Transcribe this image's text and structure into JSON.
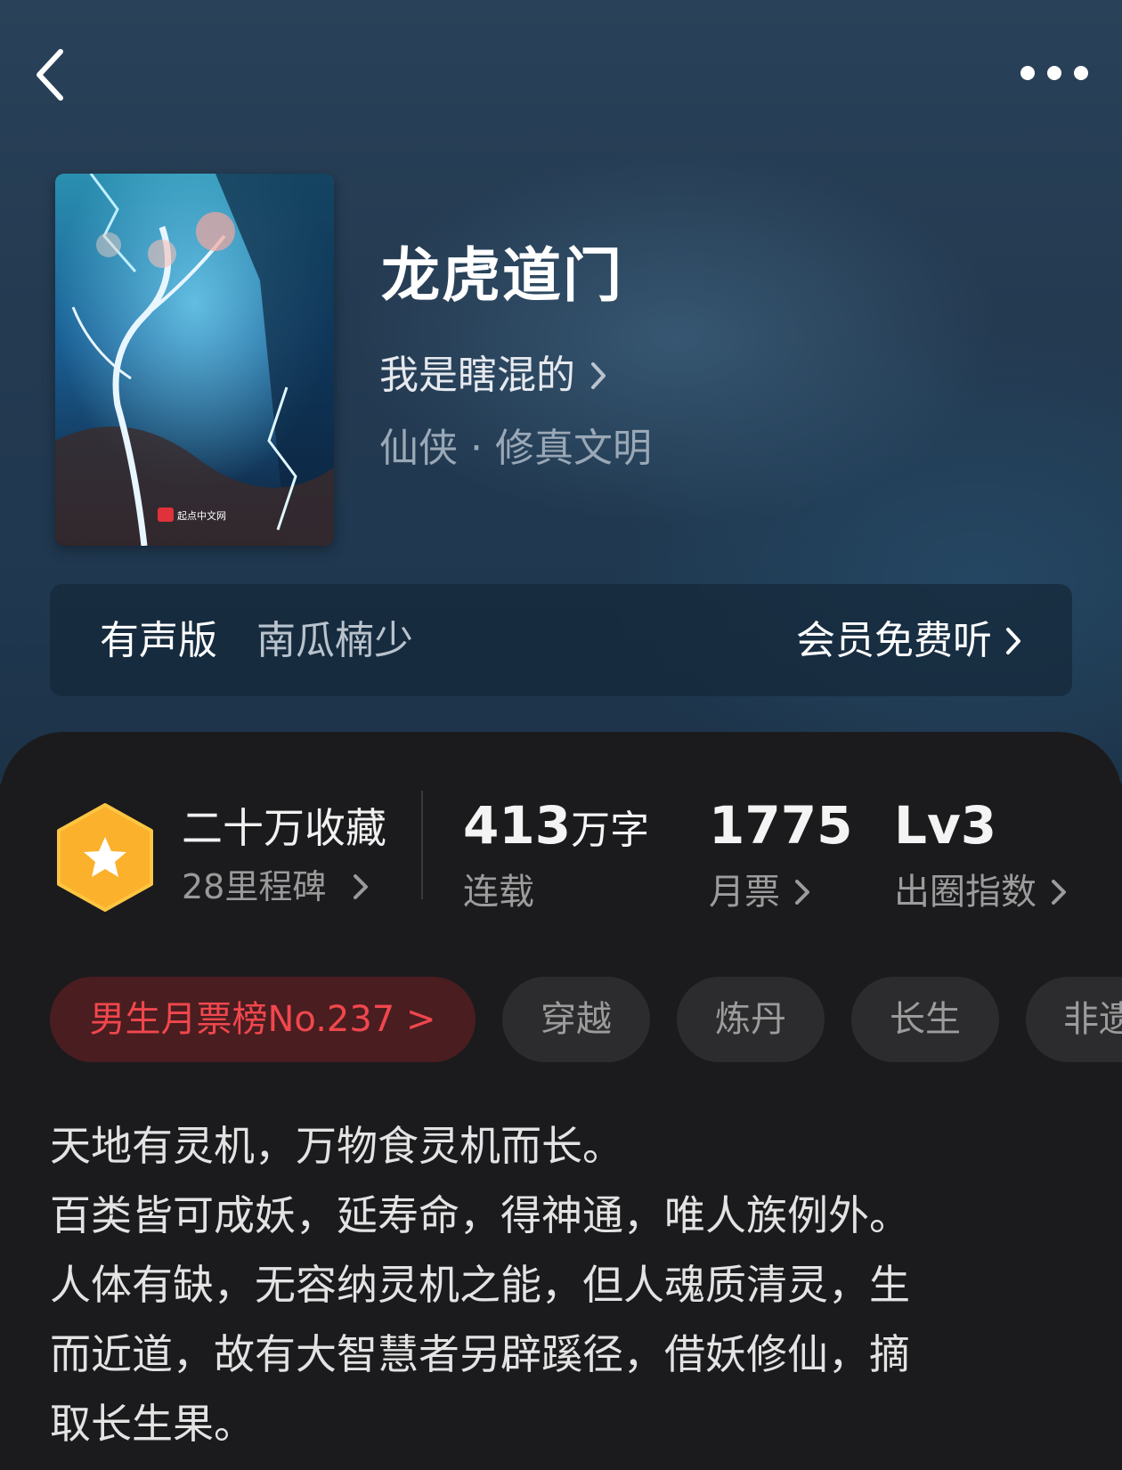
{
  "header": {
    "back_icon": "chevron-left-icon",
    "more_icon": "more-dots-icon"
  },
  "book": {
    "title": "龙虎道门",
    "author": "我是瞎混的",
    "genre": "仙侠 · 修真文明",
    "cover_publisher": "起点中文网"
  },
  "audio": {
    "label": "有声版",
    "narrator": "南瓜楠少",
    "cta": "会员免费听"
  },
  "stats": {
    "collection": "二十万收藏",
    "milestone": "28里程碑",
    "words_num": "413",
    "words_unit": "万字",
    "status": "连载",
    "monthly_votes": "1775",
    "monthly_votes_label": "月票",
    "level": "Lv3",
    "level_label": "出圈指数"
  },
  "tags": [
    "男生月票榜No.237 >",
    "穿越",
    "炼丹",
    "长生",
    "非遗"
  ],
  "description": "天地有灵机，万物食灵机而长。\n百类皆可成妖，延寿命，得神通，唯人族例外。\n人体有缺，无容纳灵机之能，但人魂质清灵，生\n而近道，故有大智慧者另辟蹊径，借妖修仙，摘\n取长生果。",
  "colors": {
    "accent_red": "#f0474d",
    "badge_orange": "#fbb12c",
    "panel_bg": "#1b1b1d"
  }
}
